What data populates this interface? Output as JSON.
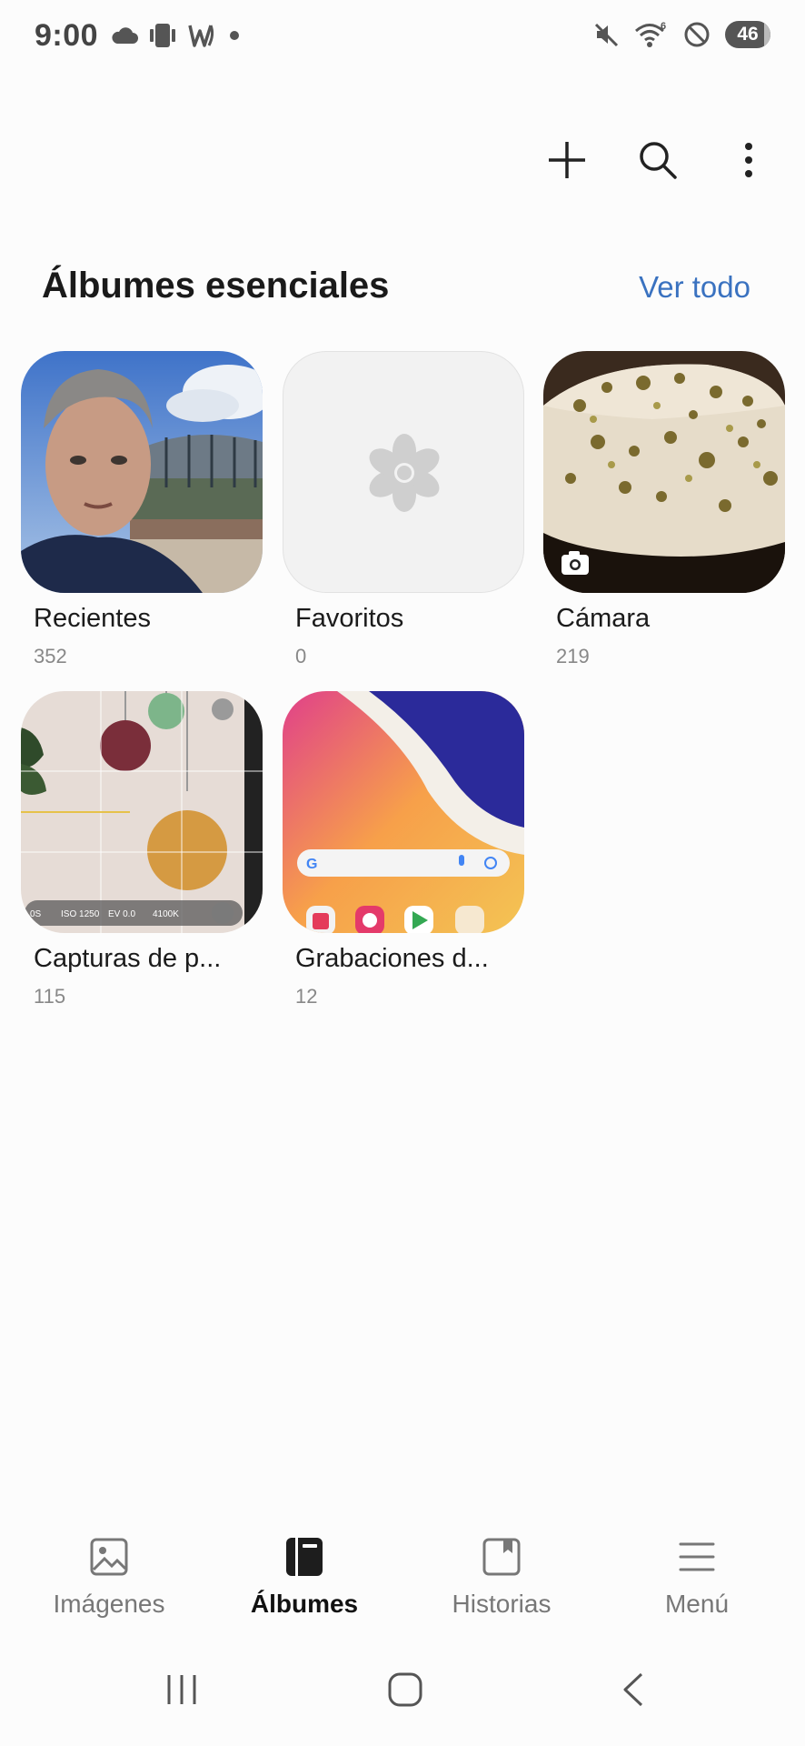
{
  "status_bar": {
    "time": "9:00",
    "battery": "46",
    "left_icons": [
      "cloud-icon",
      "vibrate-icon",
      "w-app-icon",
      "dot-icon"
    ],
    "right_icons": [
      "mute-icon",
      "wifi-6-icon",
      "do-not-disturb-icon",
      "battery-icon"
    ]
  },
  "toolbar": {
    "actions": [
      "add-icon",
      "search-icon",
      "more-options-icon"
    ]
  },
  "section": {
    "title": "Álbumes esenciales",
    "see_all": "Ver todo"
  },
  "albums": [
    {
      "name": "Recientes",
      "count": "352",
      "thumb": "selfie-photo"
    },
    {
      "name": "Favoritos",
      "count": "0",
      "thumb": "flower-placeholder"
    },
    {
      "name": "Cámara",
      "count": "219",
      "thumb": "cake-photo",
      "badge": "camera-icon"
    },
    {
      "name": "Capturas de p...",
      "count": "115",
      "thumb": "camera-ui-screenshot"
    },
    {
      "name": "Grabaciones d...",
      "count": "12",
      "thumb": "homescreen-recording"
    }
  ],
  "screenshot_overlay": {
    "iso": "ISO 1250",
    "ev": "EV 0.0",
    "wb": "4100K",
    "shutter": "0S"
  },
  "bottom_nav": {
    "items": [
      {
        "label": "Imágenes",
        "icon": "image-icon",
        "active": false
      },
      {
        "label": "Álbumes",
        "icon": "album-icon",
        "active": true
      },
      {
        "label": "Historias",
        "icon": "stories-icon",
        "active": false
      },
      {
        "label": "Menú",
        "icon": "menu-icon",
        "active": false
      }
    ]
  },
  "colors": {
    "accent": "#3a72c0",
    "background": "#fcfcfc",
    "placeholder_bg": "#f2f2f2"
  }
}
